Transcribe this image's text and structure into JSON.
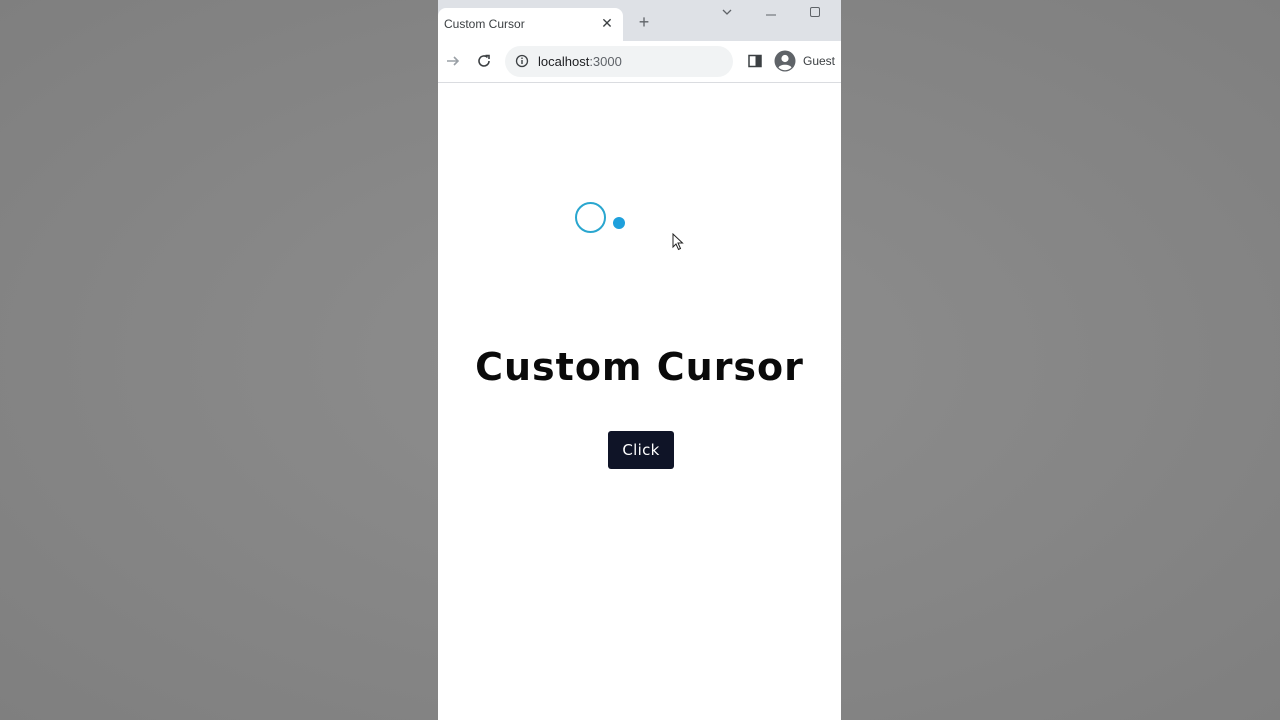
{
  "browser": {
    "tab": {
      "title": "Custom Cursor",
      "close_icon": "close-icon"
    },
    "new_tab_icon": "plus-icon",
    "window_controls": [
      "chevron-down-icon",
      "minimize-icon",
      "maximize-icon"
    ],
    "toolbar": {
      "forward_icon": "arrow-right-icon",
      "reload_icon": "reload-icon",
      "address": {
        "info_icon": "info-icon",
        "host": "localhost",
        "port": ":3000"
      },
      "side_panel_icon": "side-panel-icon",
      "profile": {
        "icon": "avatar-icon",
        "label": "Guest"
      }
    }
  },
  "page": {
    "heading": "Custom Cursor",
    "button_label": "Click",
    "cursor_colors": {
      "ring": "#29a6cf",
      "dot": "#1ea0dc"
    },
    "button_color": "#0f1427"
  }
}
